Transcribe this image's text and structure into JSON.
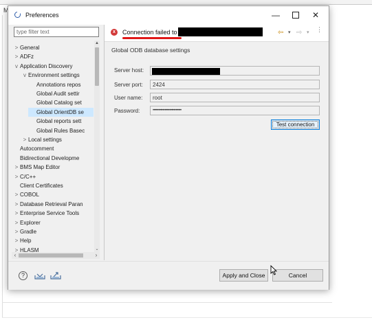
{
  "background": {
    "letter": "M"
  },
  "window": {
    "title": "Preferences",
    "minimize": "—",
    "close": "✕"
  },
  "filter": {
    "placeholder": "type filter text"
  },
  "tree": [
    {
      "label": "General",
      "arrow": ">",
      "indent": 0
    },
    {
      "label": "ADFz",
      "arrow": ">",
      "indent": 0
    },
    {
      "label": "Application Discovery",
      "arrow": "v",
      "indent": 0
    },
    {
      "label": "Environment settings",
      "arrow": "v",
      "indent": 1
    },
    {
      "label": "Annotations repos",
      "arrow": "",
      "indent": 2
    },
    {
      "label": "Global Audit settir",
      "arrow": "",
      "indent": 2
    },
    {
      "label": "Global Catalog set",
      "arrow": "",
      "indent": 2
    },
    {
      "label": "Global OrientDB se",
      "arrow": "",
      "indent": 2,
      "selected": true
    },
    {
      "label": "Global reports sett",
      "arrow": "",
      "indent": 2
    },
    {
      "label": "Global Rules Basec",
      "arrow": "",
      "indent": 2
    },
    {
      "label": "Local settings",
      "arrow": ">",
      "indent": 1
    },
    {
      "label": "Autocomment",
      "arrow": "",
      "indent": 0
    },
    {
      "label": "Bidirectional Developme",
      "arrow": "",
      "indent": 0
    },
    {
      "label": "BMS Map Editor",
      "arrow": ">",
      "indent": 0
    },
    {
      "label": "C/C++",
      "arrow": ">",
      "indent": 0
    },
    {
      "label": "Client Certificates",
      "arrow": "",
      "indent": 0
    },
    {
      "label": "COBOL",
      "arrow": ">",
      "indent": 0
    },
    {
      "label": "Database Retrieval Paran",
      "arrow": ">",
      "indent": 0
    },
    {
      "label": "Enterprise Service Tools",
      "arrow": ">",
      "indent": 0
    },
    {
      "label": "Explorer",
      "arrow": ">",
      "indent": 0
    },
    {
      "label": "Gradle",
      "arrow": ">",
      "indent": 0
    },
    {
      "label": "Help",
      "arrow": ">",
      "indent": 0
    },
    {
      "label": "HLASM",
      "arrow": ">",
      "indent": 0
    }
  ],
  "message": {
    "text": "Connection failed to",
    "status_color": "#d33a3a"
  },
  "section": {
    "title": "Global ODB database settings"
  },
  "fields": {
    "server_host": {
      "label": "Server host:",
      "value": ""
    },
    "server_port": {
      "label": "Server port:",
      "value": "2424"
    },
    "user_name": {
      "label": "User name:",
      "value": "root"
    },
    "password": {
      "label": "Password:",
      "value": "••••••••••••••••••••••••••"
    }
  },
  "buttons": {
    "test_connection": "Test connection",
    "apply_close": "Apply and Close",
    "cancel": "Cancel"
  },
  "icons": {
    "help": "?",
    "error": "x",
    "nav_back": "⇦",
    "nav_forward": "⇨",
    "dropdown": "▾",
    "menu": "⋮"
  }
}
